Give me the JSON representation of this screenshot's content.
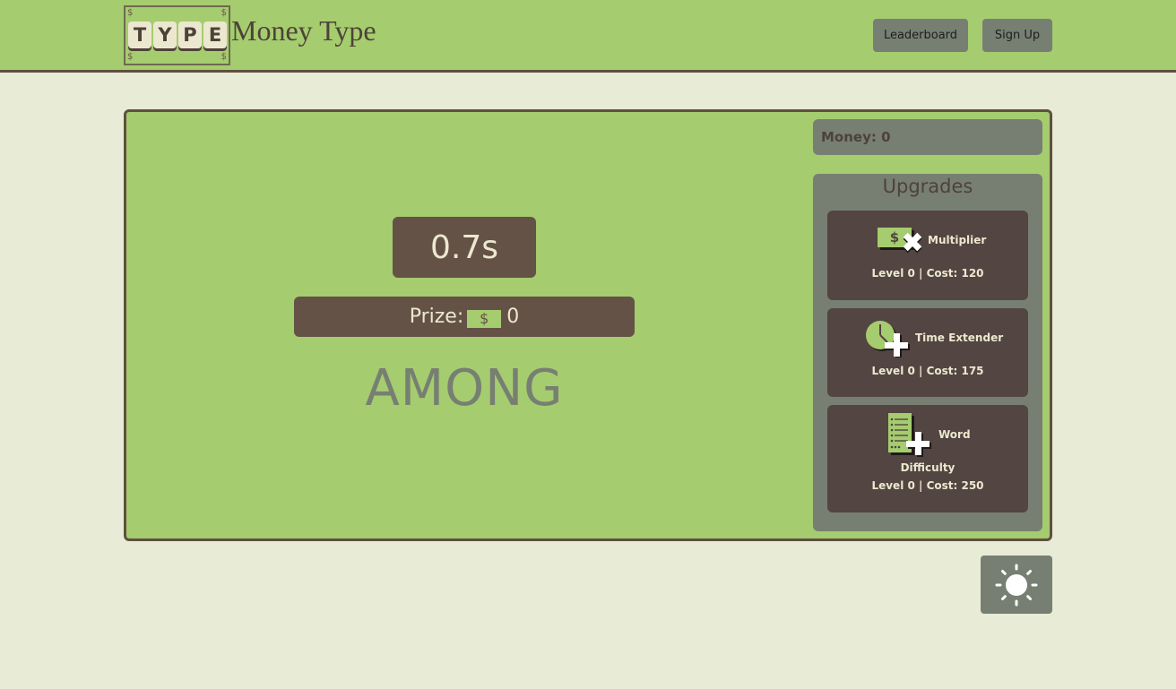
{
  "header": {
    "logo_letters": [
      "T",
      "Y",
      "P",
      "E"
    ],
    "logo_dollar": "$",
    "title": "Money Type",
    "leaderboard_label": "Leaderboard",
    "signup_label": "Sign Up"
  },
  "game": {
    "timer": "0.7s",
    "prize_label": "Prize:",
    "prize_bill": "$",
    "prize_value": "0",
    "word": "AMONG"
  },
  "sidebar": {
    "money": "Money: 0",
    "upgrades_title": "Upgrades",
    "upgrades": [
      {
        "name": "Multiplier",
        "stats": "Level 0 | Cost: 120",
        "icon": "money-multiplier-icon"
      },
      {
        "name": "Time Extender",
        "stats": "Level 0 | Cost: 175",
        "icon": "clock-plus-icon"
      },
      {
        "name_line1": "Word",
        "name_line2": "Difficulty",
        "stats": "Level 0 | Cost: 250",
        "icon": "word-list-plus-icon"
      }
    ]
  },
  "theme_toggle": {
    "icon": "sun-icon"
  },
  "colors": {
    "background": "#e8ebd6",
    "green": "#a5cc6f",
    "brown": "#645246",
    "dark_card": "#534541",
    "gray": "#777f72",
    "cream": "#ece8d0",
    "border": "#5f5040"
  }
}
